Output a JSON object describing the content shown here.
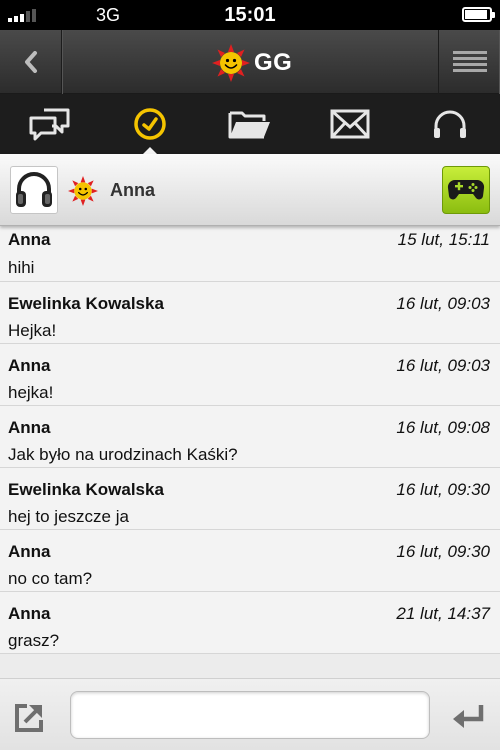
{
  "status_bar": {
    "network": "3G",
    "time": "15:01",
    "signal_bars": 3,
    "battery_level": 0.9
  },
  "title_bar": {
    "logo_text": "GG",
    "back_icon": "chevron-left-icon",
    "menu_icon": "hamburger-menu-icon"
  },
  "tabs": [
    {
      "icon": "chat-bubbles-icon",
      "active": false
    },
    {
      "icon": "clock-icon",
      "active": true
    },
    {
      "icon": "folder-icon",
      "active": false
    },
    {
      "icon": "envelope-icon",
      "active": false
    },
    {
      "icon": "headphones-icon",
      "active": false
    }
  ],
  "contact": {
    "name": "Anna",
    "avatar_icon": "headphones-icon",
    "status_icon": "gg-sun-status-icon",
    "game_icon": "gamepad-icon"
  },
  "messages": [
    {
      "sender": "Anna",
      "time": "15 lut, 15:11",
      "text": "hihi"
    },
    {
      "sender": "Ewelinka Kowalska",
      "time": "16 lut, 09:03",
      "text": "Hejka!"
    },
    {
      "sender": "Anna",
      "time": "16 lut, 09:03",
      "text": "hejka!"
    },
    {
      "sender": "Anna",
      "time": "16 lut, 09:08",
      "text": "Jak było na urodzinach Kaśki?"
    },
    {
      "sender": "Ewelinka Kowalska",
      "time": "16 lut, 09:30",
      "text": "hej to jeszcze ja"
    },
    {
      "sender": "Anna",
      "time": "16 lut, 09:30",
      "text": "no co tam?"
    },
    {
      "sender": "Anna",
      "time": "21 lut, 14:37",
      "text": "grasz?"
    }
  ],
  "input_bar": {
    "message_value": "",
    "share_icon": "share-arrow-icon",
    "send_icon": "return-arrow-icon"
  },
  "colors": {
    "accent_yellow": "#f5c400",
    "sun_red": "#e02020",
    "game_green": "#a8d92a",
    "tab_bar_bg": "#1d1d1d"
  }
}
